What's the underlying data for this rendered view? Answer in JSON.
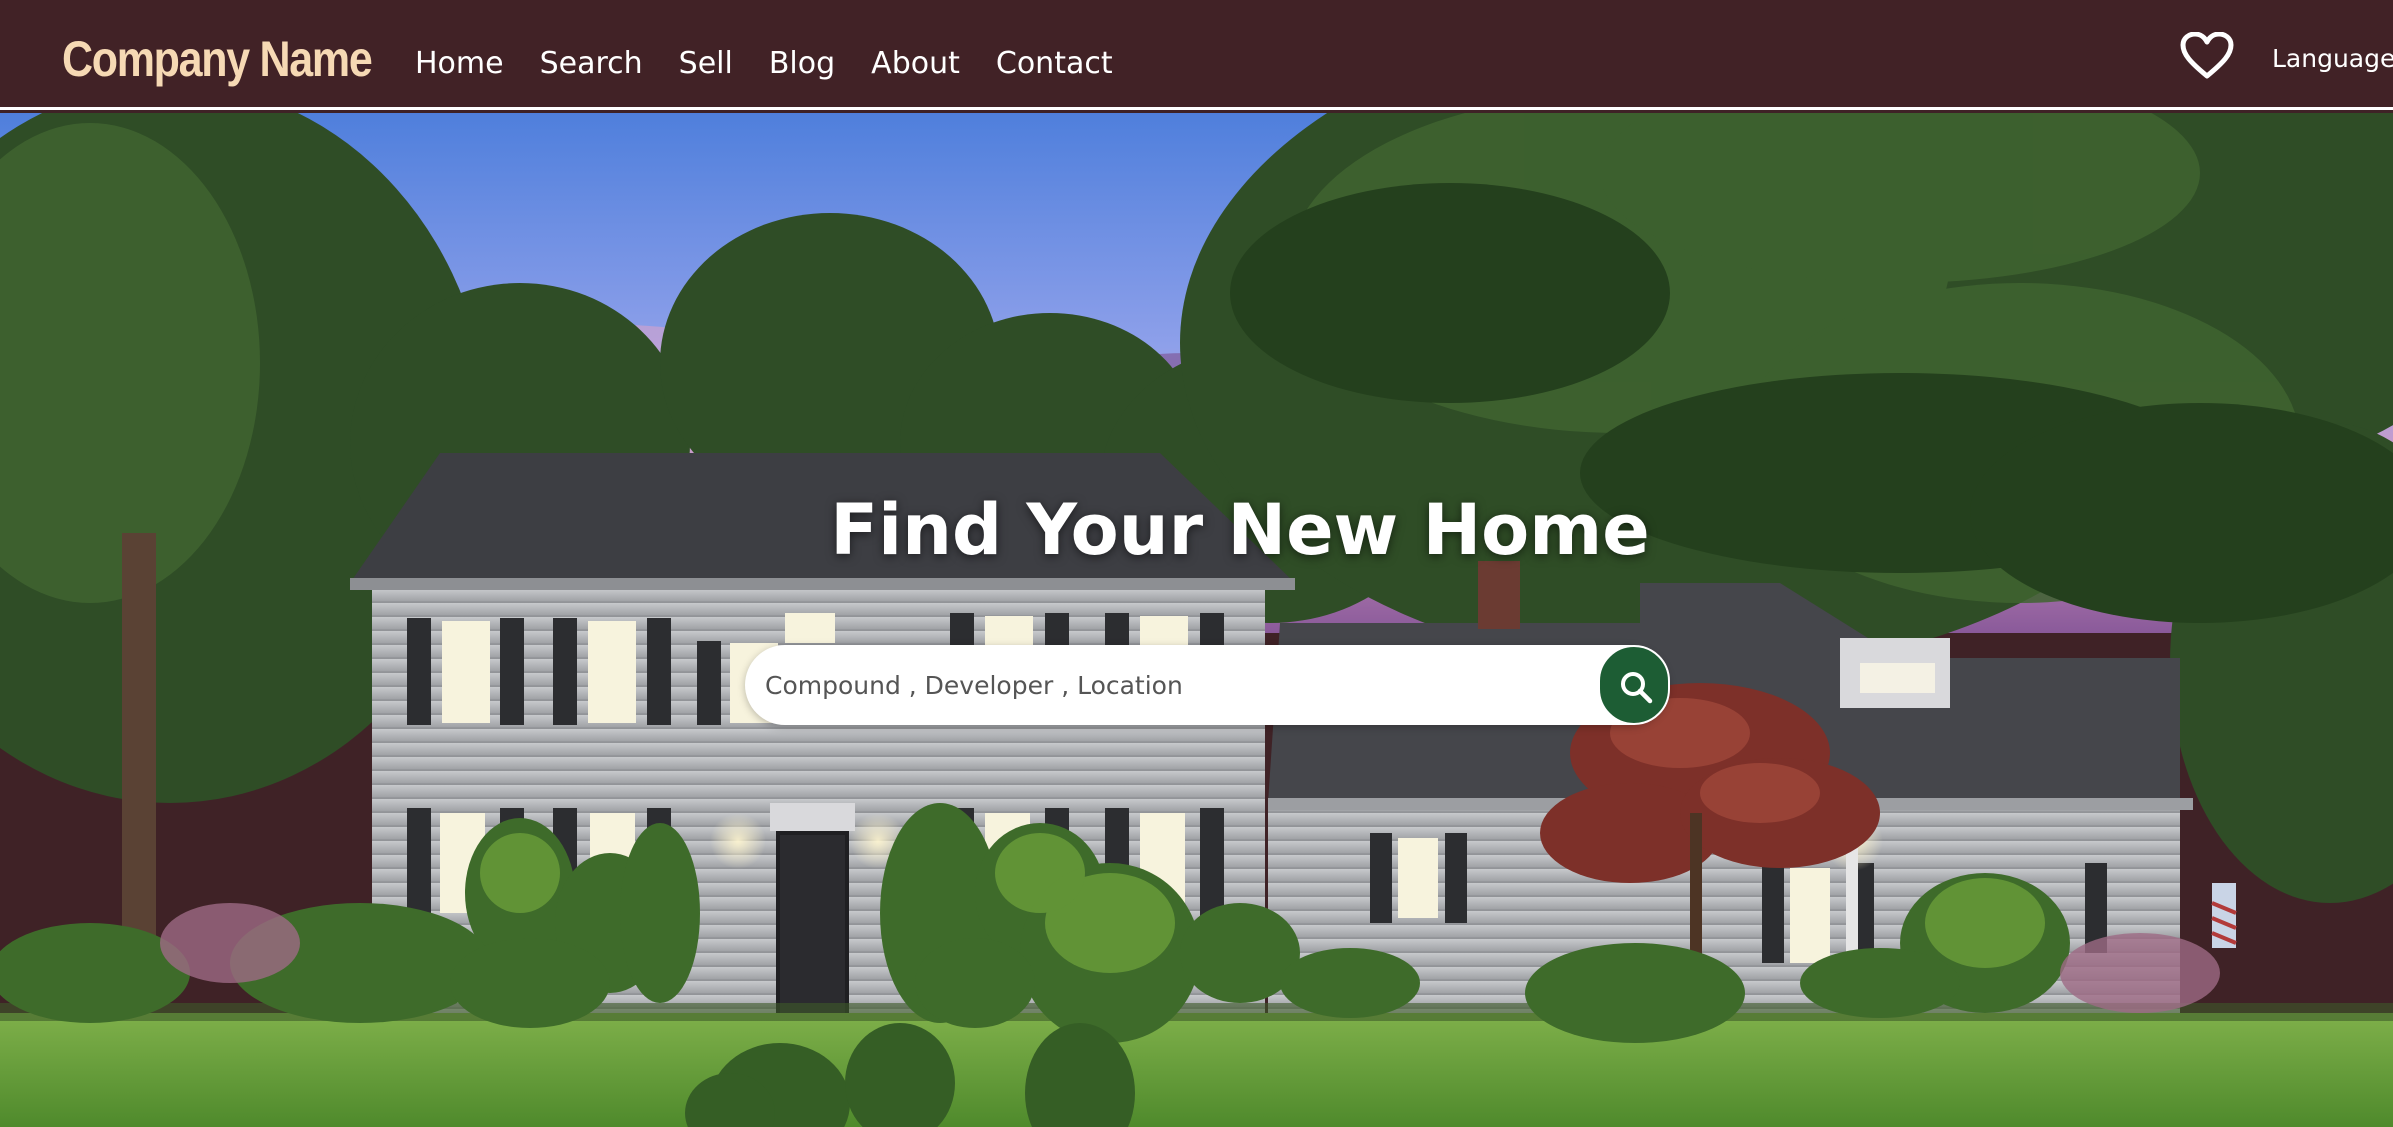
{
  "navbar": {
    "brand": "Company Name",
    "links": [
      "Home",
      "Search",
      "Sell",
      "Blog",
      "About",
      "Contact"
    ],
    "favorites_icon": "heart-icon",
    "language": "Language"
  },
  "hero": {
    "title": "Find Your New Home",
    "search": {
      "placeholder": "Compound , Developer , Location",
      "value": "",
      "button_icon": "search-icon"
    }
  },
  "colors": {
    "navbar_bg": "#412226",
    "brand": "#f6d9b4",
    "search_button": "#1d5d34"
  }
}
